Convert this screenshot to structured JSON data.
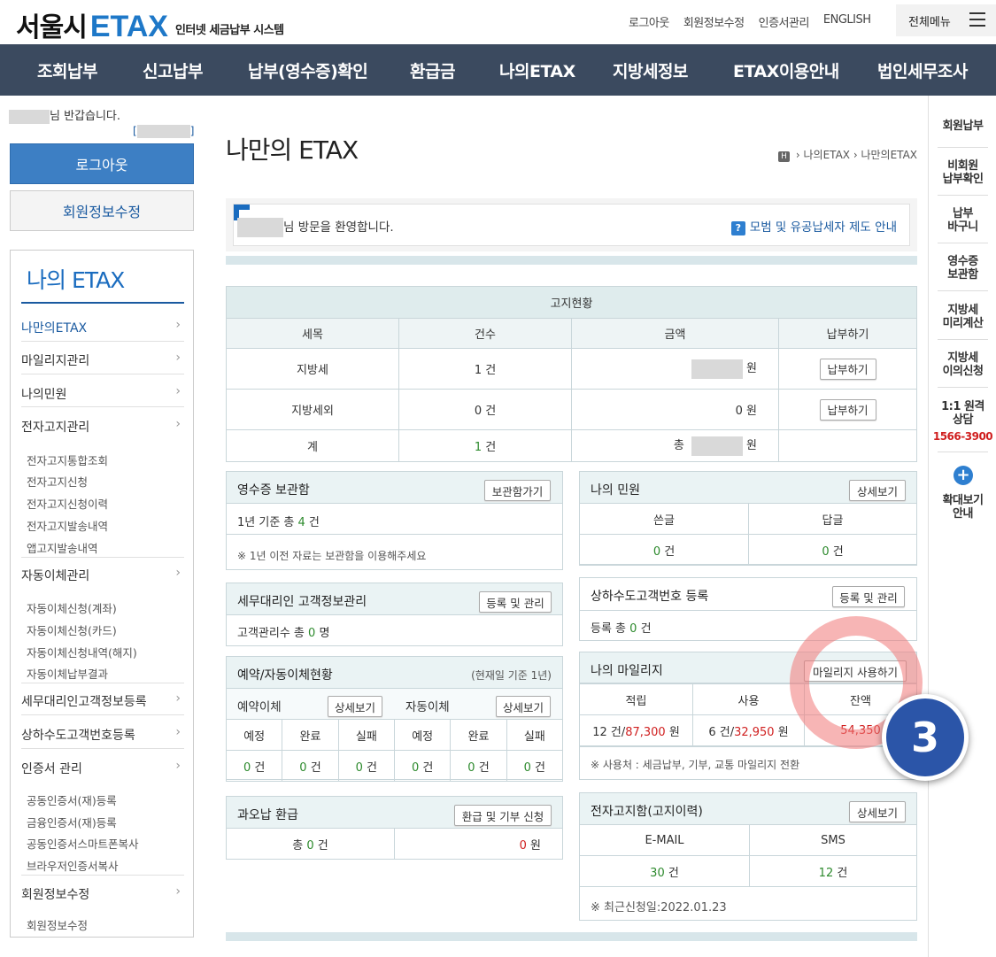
{
  "header": {
    "logo_main": "서울시",
    "logo_brand": "ETAX",
    "logo_sub": "인터넷 세금납부 시스템",
    "links": [
      "로그아웃",
      "회원정보수정",
      "인증서관리",
      "ENGLISH"
    ],
    "all_menu": "전체메뉴"
  },
  "nav": [
    "조회납부",
    "신고납부",
    "납부(영수증)확인",
    "환급금",
    "나의ETAX",
    "지방세정보",
    "ETAX이용안내",
    "법인세무조사"
  ],
  "left": {
    "greeting": "님 반갑습니다.",
    "logout": "로그아웃",
    "member_edit": "회원정보수정",
    "menu_title": "나의 ETAX",
    "items": [
      "나만의ETAX",
      "마일리지관리",
      "나의민원",
      "전자고지관리",
      "자동이체관리",
      "세무대리인고객정보등록",
      "상하수도고객번호등록",
      "인증서 관리",
      "회원정보수정"
    ],
    "sub_etax": [
      "전자고지통합조회",
      "전자고지신청",
      "전자고지신청이력",
      "전자고지발송내역",
      "앱고지발송내역"
    ],
    "sub_auto": [
      "자동이체신청(계좌)",
      "자동이체신청(카드)",
      "자동이체신청내역(해지)",
      "자동이체납부결과"
    ],
    "sub_cert": [
      "공동인증서(재)등록",
      "금융인증서(재)등록",
      "공동인증서스마트폰복사",
      "브라우저인증서복사"
    ],
    "sub_member": [
      "회원정보수정"
    ]
  },
  "right": {
    "items": [
      "회원납부",
      "비회원\n납부확인",
      "납부\n바구니",
      "영수증\n보관함",
      "지방세\n미리계산",
      "지방세\n이의신청",
      "1:1 원격\n상담",
      "확대보기\n안내"
    ],
    "phone": "1566-3900",
    "plus": "+"
  },
  "main": {
    "title": "나만의 ETAX",
    "breadcrumb": [
      "H",
      "나의ETAX",
      "나만의ETAX"
    ],
    "welcome": "님 방문을 환영합니다.",
    "welcome_link": "모범 및 유공납세자 제도 안내",
    "notice": {
      "title": "고지현황",
      "headers": [
        "세목",
        "건수",
        "금액",
        "납부하기"
      ],
      "rows": [
        {
          "name": "지방세",
          "count": "1 건",
          "amount_unit": "원",
          "btn": "납부하기"
        },
        {
          "name": "지방세외",
          "count": "0 건",
          "amount": "0 원",
          "btn": "납부하기"
        },
        {
          "name": "계",
          "count_num": "1",
          "count_unit": " 건",
          "amount_prefix": "총",
          "amount_unit": "원"
        }
      ]
    },
    "receipt": {
      "title": "영수증 보관함",
      "btn": "보관함가기",
      "line1a": "1년 기준 총 ",
      "line1b": "4",
      "line1c": " 건",
      "note": "※ 1년 이전 자료는 보관함을 이용해주세요"
    },
    "civil": {
      "title": "나의 민원",
      "btn": "상세보기",
      "h1": "쓴글",
      "h2": "답글",
      "v1": "0",
      "v2": "0",
      "unit": " 건"
    },
    "agent": {
      "title": "세무대리인 고객정보관리",
      "btn": "등록 및 관리",
      "line_a": "고객관리수 총 ",
      "line_b": "0",
      "line_c": " 명"
    },
    "water": {
      "title": "상하수도고객번호 등록",
      "btn": "등록 및 관리",
      "line_a": "등록 총 ",
      "line_b": "0",
      "line_c": " 건"
    },
    "reserve": {
      "title": "예약/자동이체현황",
      "subtitle": "(현재일 기준 1년)",
      "left_title": "예약이체",
      "right_title": "자동이체",
      "btn": "상세보기",
      "cols": [
        "예정",
        "완료",
        "실패",
        "예정",
        "완료",
        "실패"
      ],
      "vals": [
        "0",
        "0",
        "0",
        "0",
        "0",
        "0"
      ],
      "unit": " 건"
    },
    "mileage": {
      "title": "나의 마일리지",
      "btn": "마일리지 사용하기",
      "h": [
        "적립",
        "사용",
        "잔액"
      ],
      "earn_a": "12 건/",
      "earn_b": "87,300",
      "earn_c": " 원",
      "use_a": "6 건/",
      "use_b": "32,950",
      "use_c": " 원",
      "balance": "54,350",
      "note": "※ 사용처 : 세금납부, 기부, 교통 마일리지 전환"
    },
    "refund": {
      "title": "과오납 환급",
      "btn": "환급 및 기부 신청",
      "left_a": "총 ",
      "left_b": "0",
      "left_c": " 건",
      "right_a": "0",
      "right_b": " 원"
    },
    "enotice": {
      "title": "전자고지함(고지이력)",
      "btn": "상세보기",
      "h1": "E-MAIL",
      "h2": "SMS",
      "v1": "30",
      "v2": "12",
      "unit": " 건",
      "note": "※ 최근신청일:2022.01.23"
    }
  },
  "overlay": {
    "badge": "3"
  }
}
